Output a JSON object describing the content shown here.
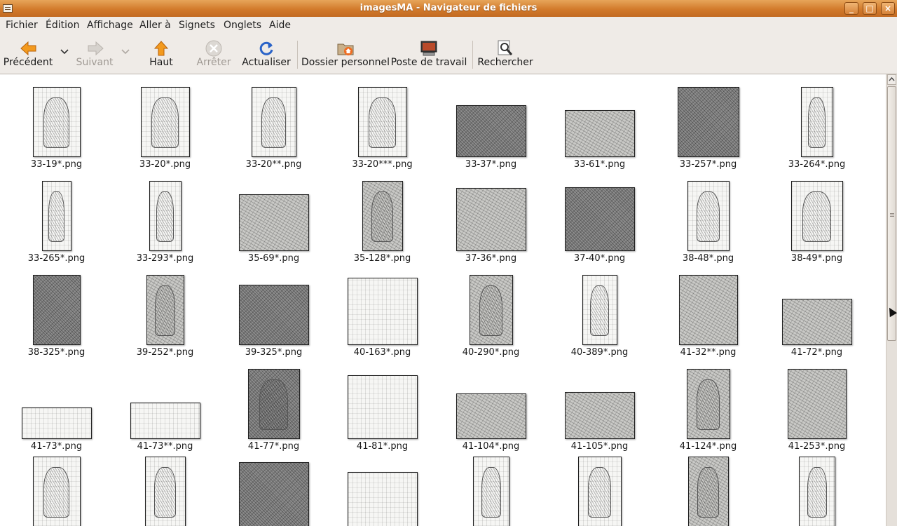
{
  "window": {
    "title": "imagesMA - Navigateur de fichiers",
    "minimize_label": "_",
    "maximize_label": "□",
    "close_label": "×",
    "accent": "#d27a2b"
  },
  "menu": {
    "items": [
      {
        "label": "Fichier"
      },
      {
        "label": "Édition"
      },
      {
        "label": "Affichage"
      },
      {
        "label": "Aller à"
      },
      {
        "label": "Signets"
      },
      {
        "label": "Onglets"
      },
      {
        "label": "Aide"
      }
    ]
  },
  "toolbar": {
    "back": {
      "label": "Précédent",
      "icon": "arrow-left-icon"
    },
    "forward": {
      "label": "Suivant",
      "icon": "arrow-right-icon",
      "disabled": true
    },
    "up": {
      "label": "Haut",
      "icon": "arrow-up-icon"
    },
    "stop": {
      "label": "Arrêter",
      "icon": "stop-icon",
      "disabled": true
    },
    "reload": {
      "label": "Actualiser",
      "icon": "reload-icon"
    },
    "home": {
      "label": "Dossier personnel",
      "icon": "home-folder-icon"
    },
    "computer": {
      "label": "Poste de travail",
      "icon": "computer-icon"
    },
    "search": {
      "label": "Rechercher",
      "icon": "search-icon"
    }
  },
  "files": [
    {
      "name": "33-19*.png"
    },
    {
      "name": "33-20*.png"
    },
    {
      "name": "33-20**.png"
    },
    {
      "name": "33-20***.png"
    },
    {
      "name": "33-37*.png"
    },
    {
      "name": "33-61*.png"
    },
    {
      "name": "33-257*.png"
    },
    {
      "name": "33-264*.png"
    },
    {
      "name": "33-265*.png"
    },
    {
      "name": "33-293*.png"
    },
    {
      "name": "35-69*.png"
    },
    {
      "name": "35-128*.png"
    },
    {
      "name": "37-36*.png"
    },
    {
      "name": "37-40*.png"
    },
    {
      "name": "38-48*.png"
    },
    {
      "name": "38-49*.png"
    },
    {
      "name": "38-325*.png"
    },
    {
      "name": "39-252*.png"
    },
    {
      "name": "39-325*.png"
    },
    {
      "name": "40-163*.png"
    },
    {
      "name": "40-290*.png"
    },
    {
      "name": "40-389*.png"
    },
    {
      "name": "41-32**.png"
    },
    {
      "name": "41-72*.png"
    },
    {
      "name": "41-73*.png"
    },
    {
      "name": "41-73**.png"
    },
    {
      "name": "41-77*.png"
    },
    {
      "name": "41-81*.png"
    },
    {
      "name": "41-104*.png"
    },
    {
      "name": "41-105*.png"
    },
    {
      "name": "41-124*.png"
    },
    {
      "name": "41-253*.png"
    },
    {
      "name": ""
    },
    {
      "name": ""
    },
    {
      "name": ""
    },
    {
      "name": ""
    },
    {
      "name": ""
    },
    {
      "name": ""
    },
    {
      "name": ""
    },
    {
      "name": ""
    }
  ],
  "scroll": {
    "position_fraction": 0.0,
    "visible_fraction": 0.55
  }
}
